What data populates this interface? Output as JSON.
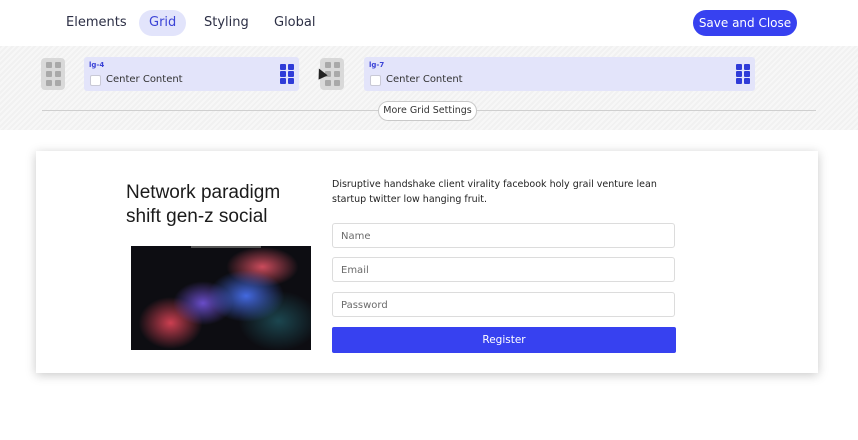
{
  "tabs": [
    {
      "label": "Elements"
    },
    {
      "label": "Grid",
      "active": true
    },
    {
      "label": "Styling"
    },
    {
      "label": "Global"
    }
  ],
  "save_button": "Save and Close",
  "grid_columns": [
    {
      "label": "lg-4",
      "checkbox_label": "Center Content",
      "checked": false
    },
    {
      "label": "lg-7",
      "checkbox_label": "Center Content",
      "checked": false
    }
  ],
  "more_grid_settings": "More Grid Settings",
  "preview": {
    "heading": "Network paradigm shift gen-z social",
    "description": "Disruptive handshake client virality facebook holy grail venture lean startup twitter low hanging fruit.",
    "fields": [
      {
        "placeholder": "Name"
      },
      {
        "placeholder": "Email"
      },
      {
        "placeholder": "Password"
      }
    ],
    "register_label": "Register"
  },
  "colors": {
    "accent": "#3741f0",
    "tab_active_bg": "#e2e4fb",
    "column_bg": "#e3e4fa"
  }
}
